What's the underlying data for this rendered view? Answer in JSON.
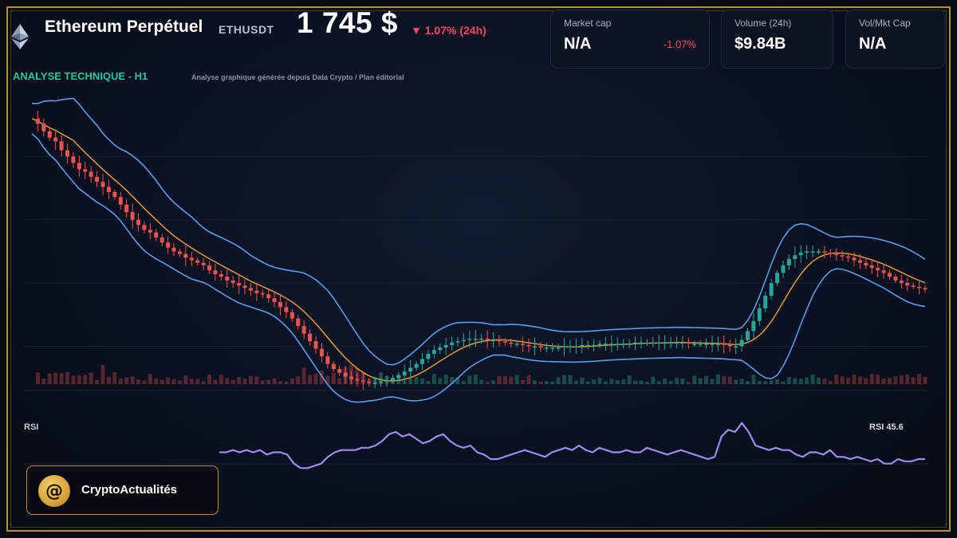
{
  "header": {
    "title": "Ethereum Perpétuel",
    "ticker": "ETHUSDT",
    "price": "1 745 $",
    "change": "▼ 1.07% (24h)"
  },
  "cards": [
    {
      "label": "Market cap",
      "value": "N/A",
      "sub": "-1.07%"
    },
    {
      "label": "Volume (24h)",
      "value": "$9.84B",
      "sub": ""
    },
    {
      "label": "Vol/Mkt Cap",
      "value": "N/A",
      "sub": ""
    }
  ],
  "section_title": "ANALYSE TECHNIQUE - H1",
  "source": "Analyse graphique générée depuis Data Crypto / Plan éditorial",
  "rsi": {
    "label": "RSI",
    "value": "RSI 45.6"
  },
  "brand": {
    "name": "CryptoActualités"
  },
  "colors": {
    "up": "#26a69a",
    "down": "#ef5350",
    "bollinger": "#5b9cf0",
    "ma": "#f0a32a",
    "rsi": "#9d8cf2",
    "accent": "#25c4a0",
    "frame": "#b8912f"
  },
  "chart_data": {
    "type": "candlestick",
    "title": "ANALYSE TECHNIQUE - H1",
    "price_series": [
      1880,
      1876,
      1870,
      1865,
      1862,
      1855,
      1850,
      1845,
      1840,
      1838,
      1834,
      1830,
      1826,
      1822,
      1818,
      1812,
      1806,
      1800,
      1796,
      1792,
      1790,
      1786,
      1782,
      1778,
      1775,
      1773,
      1770,
      1768,
      1766,
      1764,
      1760,
      1757,
      1755,
      1752,
      1750,
      1748,
      1746,
      1744,
      1742,
      1741,
      1738,
      1735,
      1731,
      1727,
      1722,
      1716,
      1710,
      1704,
      1698,
      1692,
      1686,
      1682,
      1679,
      1676,
      1674,
      1673,
      1672,
      1671,
      1671,
      1672,
      1673,
      1675,
      1677,
      1680,
      1683,
      1686,
      1690,
      1694,
      1697,
      1699,
      1701,
      1703,
      1704,
      1705,
      1706,
      1706,
      1706,
      1705,
      1705,
      1704,
      1703,
      1702,
      1702,
      1701,
      1700,
      1700,
      1699,
      1699,
      1699,
      1699,
      1700,
      1700,
      1700,
      1701,
      1701,
      1701,
      1702,
      1702,
      1702,
      1702,
      1702,
      1702,
      1703,
      1703,
      1703,
      1703,
      1703,
      1703,
      1703,
      1703,
      1703,
      1702,
      1702,
      1702,
      1702,
      1702,
      1702,
      1701,
      1700,
      1700,
      1705,
      1712,
      1720,
      1730,
      1740,
      1750,
      1758,
      1764,
      1769,
      1772,
      1774,
      1775,
      1775,
      1775,
      1774,
      1773,
      1772,
      1771,
      1770,
      1768,
      1766,
      1764,
      1762,
      1760,
      1758,
      1755,
      1752,
      1750,
      1748,
      1747,
      1746,
      1745
    ],
    "rsi_series": [
      55,
      55,
      56,
      55,
      56,
      55,
      56,
      54,
      55,
      55,
      54,
      50,
      48,
      48,
      49,
      50,
      53,
      55,
      56,
      56,
      56,
      57,
      57,
      58,
      60,
      63,
      64,
      62,
      63,
      61,
      59,
      60,
      62,
      63,
      60,
      58,
      57,
      58,
      55,
      54,
      52,
      52,
      53,
      54,
      55,
      56,
      55,
      54,
      53,
      55,
      56,
      57,
      56,
      58,
      56,
      55,
      57,
      56,
      55,
      55,
      56,
      55,
      55,
      57,
      56,
      55,
      54,
      55,
      56,
      55,
      54,
      53,
      52,
      53,
      62,
      65,
      64,
      68,
      64,
      58,
      57,
      56,
      57,
      56,
      56,
      54,
      53,
      55,
      55,
      54,
      56,
      53,
      53,
      52,
      53,
      52,
      51,
      52,
      50,
      50,
      52,
      51,
      51,
      52,
      52
    ],
    "rsi_value": 45.6,
    "ylim": [
      1665,
      1895
    ],
    "indicators": [
      "Bollinger Bands",
      "Moving Average",
      "Volume",
      "RSI"
    ],
    "grid": true,
    "legend": "none"
  }
}
